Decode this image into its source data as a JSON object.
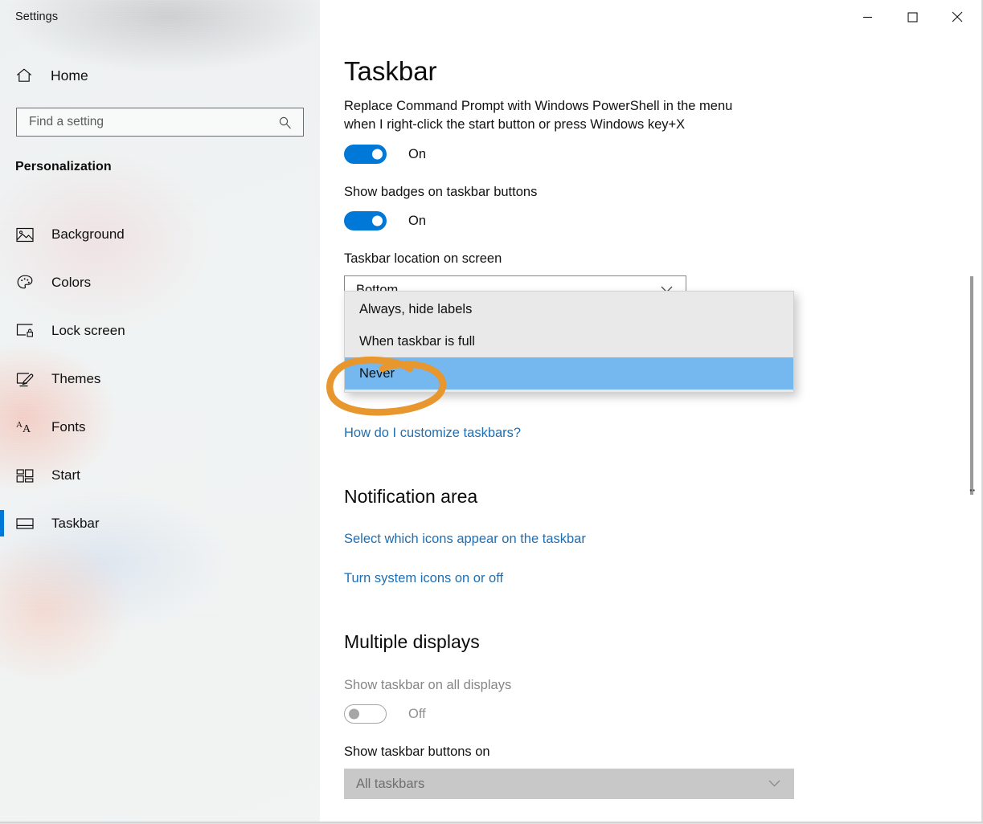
{
  "window": {
    "title": "Settings",
    "controls": [
      {
        "name": "minimize",
        "glyph": "minimize-icon"
      },
      {
        "name": "maximize",
        "glyph": "maximize-icon"
      },
      {
        "name": "close",
        "glyph": "close-icon"
      }
    ]
  },
  "sidebar": {
    "home_label": "Home",
    "home_icon": "home-icon",
    "search": {
      "placeholder": "Find a setting",
      "value": "",
      "icon": "search-icon"
    },
    "category": "Personalization",
    "items": [
      {
        "label": "Background",
        "icon": "image-icon",
        "selected": false
      },
      {
        "label": "Colors",
        "icon": "palette-icon",
        "selected": false
      },
      {
        "label": "Lock screen",
        "icon": "lock-screen-icon",
        "selected": false
      },
      {
        "label": "Themes",
        "icon": "brush-icon",
        "selected": false
      },
      {
        "label": "Fonts",
        "icon": "fonts-icon",
        "selected": false
      },
      {
        "label": "Start",
        "icon": "start-icon",
        "selected": false
      },
      {
        "label": "Taskbar",
        "icon": "taskbar-icon",
        "selected": true
      }
    ]
  },
  "main": {
    "page_title": "Taskbar",
    "settings": {
      "powershell_label": "Replace Command Prompt with Windows PowerShell in the menu when I right-click the start button or press Windows key+X",
      "powershell_toggle": "On",
      "badges_label": "Show badges on taskbar buttons",
      "badges_toggle": "On",
      "location_label": "Taskbar location on screen",
      "location_value": "Bottom",
      "customize_link": "How do I customize taskbars?"
    },
    "dropdown": {
      "open": true,
      "options": [
        {
          "label": "Always, hide labels",
          "selected": false
        },
        {
          "label": "When taskbar is full",
          "selected": false
        },
        {
          "label": "Never",
          "selected": true
        }
      ]
    },
    "notification_area": {
      "heading": "Notification area",
      "links": [
        "Select which icons appear on the taskbar",
        "Turn system icons on or off"
      ]
    },
    "multiple_displays": {
      "heading": "Multiple displays",
      "all_displays_label": "Show taskbar on all displays",
      "all_displays_toggle": "Off",
      "buttons_on_label": "Show taskbar buttons on",
      "buttons_on_value": "All taskbars"
    }
  },
  "annotation": {
    "type": "hand-drawn-ellipse",
    "color": "#e8962e",
    "target": "Never"
  },
  "colors": {
    "accent": "#0078d7",
    "highlight": "#74b8ef",
    "link": "#1e6fb4",
    "dropdown_bg": "#e9e9e9",
    "annotation": "#e8962e",
    "disabled_bg": "#c8c8c8"
  },
  "scrollbar": {
    "visible": true
  }
}
